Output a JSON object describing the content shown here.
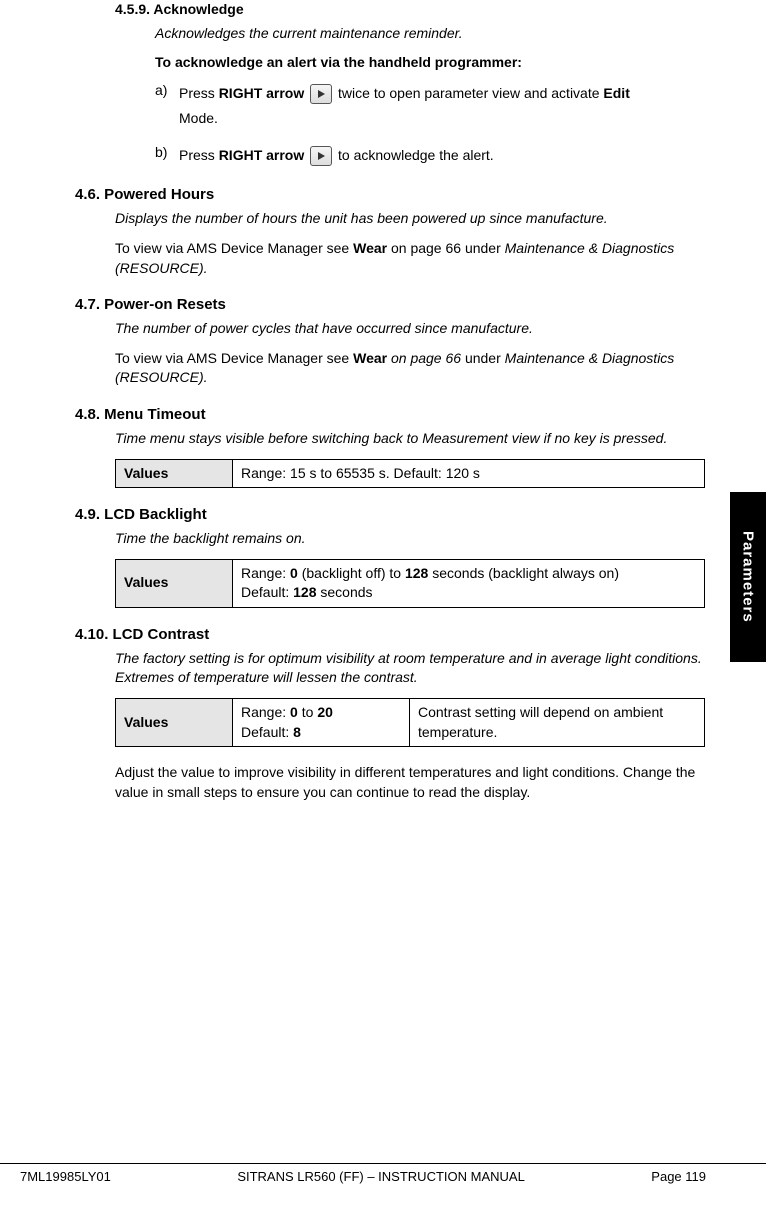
{
  "sideTab": "Parameters",
  "s459": {
    "heading": "4.5.9.  Acknowledge",
    "desc": "Acknowledges the current maintenance reminder.",
    "toLine": "To acknowledge an alert via the handheld programmer:",
    "stepA_label": "a)",
    "stepA_1": "Press ",
    "stepA_bold1": "RIGHT arrow",
    "stepA_2": " twice to open parameter view and activate ",
    "stepA_bold2": "Edit",
    "stepA_3": " Mode.",
    "stepB_label": "b)",
    "stepB_1": "Press ",
    "stepB_bold1": "RIGHT arrow",
    "stepB_2": " to acknowledge the alert."
  },
  "s46": {
    "heading": "4.6.  Powered Hours",
    "desc": "Displays the number of hours the unit has been powered up since manufacture.",
    "body_1": "To view via AMS Device Manager see ",
    "body_bold": "Wear",
    "body_2": " on page 66 under ",
    "body_it": "Maintenance & Diagnostics (RESOURCE)."
  },
  "s47": {
    "heading": "4.7.  Power-on Resets",
    "desc": "The number of power cycles that have occurred since manufacture.",
    "body_1": "To view via AMS Device Manager see ",
    "body_bold": "Wear",
    "body_it1": " on page 66 ",
    "body_2": "under ",
    "body_it2": "Maintenance & Diagnostics (RESOURCE)."
  },
  "s48": {
    "heading": "4.8.  Menu Timeout",
    "desc": "Time menu stays visible before switching back to Measurement view if no key is pressed.",
    "tableLabel": "Values",
    "tableValue": "Range: 15 s to 65535 s. Default: 120 s"
  },
  "s49": {
    "heading": "4.9.  LCD Backlight",
    "desc": "Time the backlight remains on.",
    "tableLabel": "Values",
    "row_1": "Range: ",
    "row_b1": "0",
    "row_2": " (backlight off) to ",
    "row_b2": "128",
    "row_3": " seconds (backlight always on)",
    "row_4": "Default: ",
    "row_b3": "128",
    "row_5": " seconds"
  },
  "s410": {
    "heading": "4.10. LCD Contrast",
    "desc": "The factory setting is for optimum visibility at room temperature and in average light conditions. Extremes of temperature will lessen the contrast.",
    "tableLabel": "Values",
    "c1_1": "Range: ",
    "c1_b1": "0",
    "c1_2": " to ",
    "c1_b2": "20",
    "c1_3": "Default: ",
    "c1_b3": "8",
    "c2": "Contrast setting will depend on ambient temperature.",
    "after": "Adjust the value to improve visibility in different temperatures and light conditions. Change the value in small steps to ensure you can continue to read the display."
  },
  "footer": {
    "left": "7ML19985LY01",
    "mid": "SITRANS LR560 (FF) – INSTRUCTION MANUAL",
    "right": "Page 119"
  }
}
